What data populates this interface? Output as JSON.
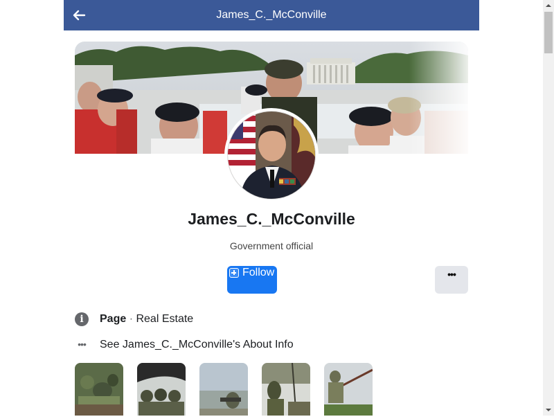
{
  "header": {
    "title": "James_C._McConville",
    "back_icon": "back-arrow-icon",
    "bg_color": "#3b5998"
  },
  "profile": {
    "name": "James_C._McConville",
    "category": "Government official"
  },
  "actions": {
    "follow_label": "Follow",
    "follow_icon": "add-square-icon",
    "more_label": "•••",
    "accent_color": "#1877f2"
  },
  "info": {
    "page_label": "Page",
    "separator": " · ",
    "page_type": "Real Estate",
    "about_link": "See James_C._McConville's About Info",
    "info_icon_glyph": "i",
    "dots_glyph": "•••"
  },
  "photos": {
    "count": 5
  }
}
